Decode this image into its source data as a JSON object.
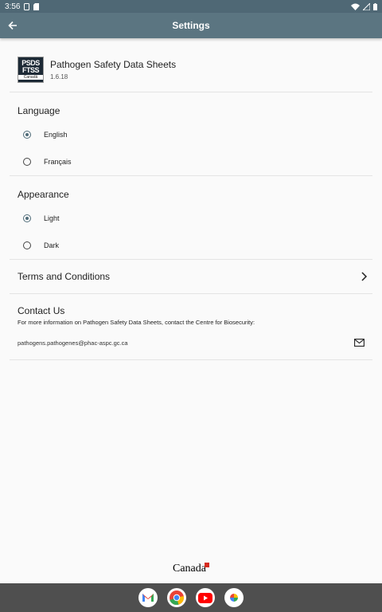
{
  "status_bar": {
    "time": "3:56"
  },
  "app_bar": {
    "title": "Settings",
    "back_icon": "arrow-left-icon"
  },
  "app_info": {
    "logo_line1": "PSDS",
    "logo_line2": "FTSS",
    "logo_line3": "Canadä",
    "name": "Pathogen Safety Data Sheets",
    "version": "1.6.18"
  },
  "language": {
    "title": "Language",
    "options": [
      {
        "label": "English",
        "selected": true
      },
      {
        "label": "Français",
        "selected": false
      }
    ]
  },
  "appearance": {
    "title": "Appearance",
    "options": [
      {
        "label": "Light",
        "selected": true
      },
      {
        "label": "Dark",
        "selected": false
      }
    ]
  },
  "terms": {
    "label": "Terms and Conditions"
  },
  "contact": {
    "title": "Contact Us",
    "description": "For more information on Pathogen Safety Data Sheets, contact the Centre for Biosecurity:",
    "email": "pathogens.pathogenes@phac-aspc.gc.ca"
  },
  "footer": {
    "wordmark": "Canada"
  },
  "dock": {
    "apps": [
      "gmail-icon",
      "chrome-icon",
      "youtube-icon",
      "photos-icon"
    ]
  },
  "colors": {
    "status_bar": "#4f6875",
    "app_bar": "#5b7581",
    "radio_accent": "#506c79",
    "nav_bar": "#4f4f4f"
  }
}
